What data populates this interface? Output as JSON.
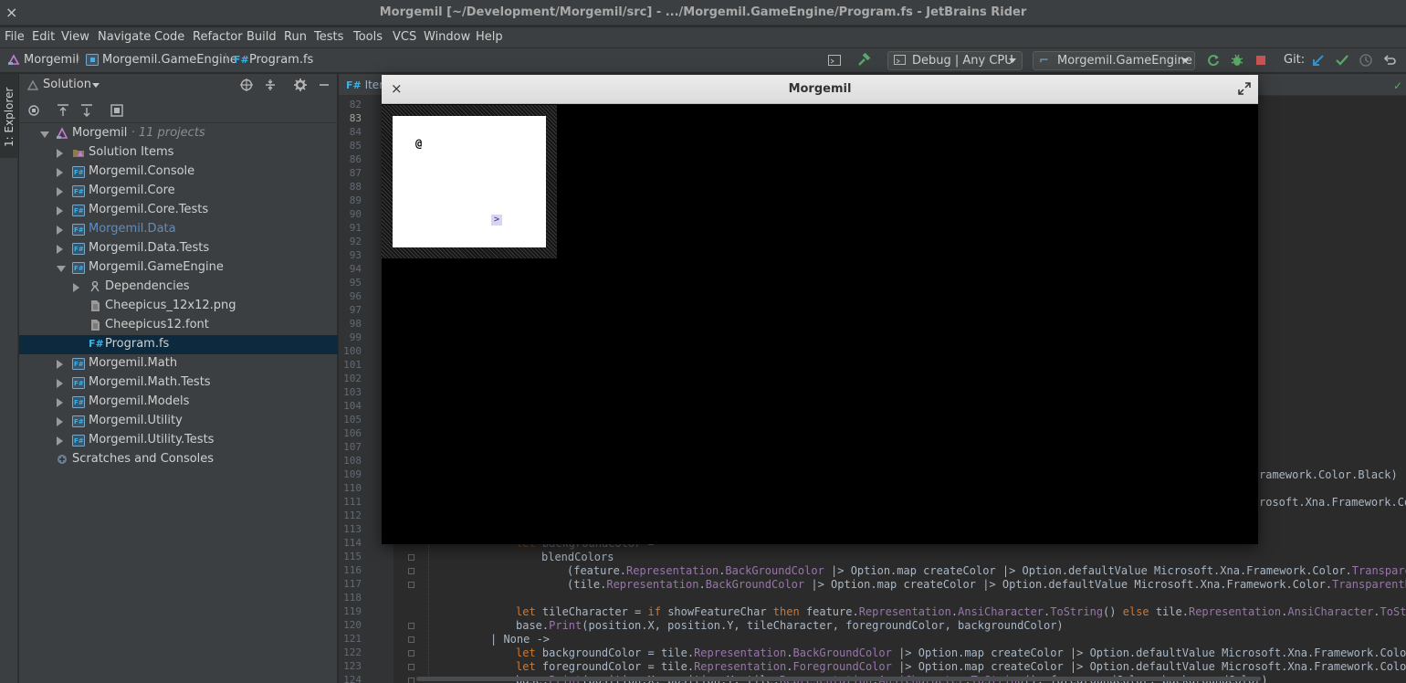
{
  "window": {
    "title": "Morgemil [~/Development/Morgemil/src] - .../Morgemil.GameEngine/Program.fs - JetBrains Rider",
    "close_glyph": "×"
  },
  "menu": [
    "File",
    "Edit",
    "View",
    "Navigate",
    "Code",
    "Refactor",
    "Build",
    "Run",
    "Tests",
    "Tools",
    "VCS",
    "Window",
    "Help"
  ],
  "breadcrumb": {
    "items": [
      "Morgemil",
      "Morgemil.GameEngine",
      "Program.fs"
    ],
    "fs_badge": "F#"
  },
  "toolbar": {
    "config_combo": "Debug | Any CPU",
    "project_combo": "Morgemil.GameEngine",
    "git_label": "Git:"
  },
  "explorer_strip": {
    "label": "1: Explorer"
  },
  "solution_panel": {
    "title": "Solution",
    "tree": [
      {
        "label": "Morgemil",
        "suffix": " · 11 projects",
        "level": 0,
        "state": "down",
        "icon": "solution"
      },
      {
        "label": "Solution Items",
        "level": 1,
        "state": "right",
        "icon": "folder-solution"
      },
      {
        "label": "Morgemil.Console",
        "level": 1,
        "state": "right",
        "icon": "fsproj"
      },
      {
        "label": "Morgemil.Core",
        "level": 1,
        "state": "right",
        "icon": "fsproj"
      },
      {
        "label": "Morgemil.Core.Tests",
        "level": 1,
        "state": "right",
        "icon": "fsproj"
      },
      {
        "label": "Morgemil.Data",
        "level": 1,
        "state": "right",
        "icon": "fsproj",
        "highlight": true
      },
      {
        "label": "Morgemil.Data.Tests",
        "level": 1,
        "state": "right",
        "icon": "fsproj"
      },
      {
        "label": "Morgemil.GameEngine",
        "level": 1,
        "state": "down",
        "icon": "fsproj"
      },
      {
        "label": "Dependencies",
        "level": 2,
        "state": "right",
        "icon": "deps"
      },
      {
        "label": "Cheepicus_12x12.png",
        "level": 2,
        "state": "none",
        "icon": "file"
      },
      {
        "label": "Cheepicus12.font",
        "level": 2,
        "state": "none",
        "icon": "file"
      },
      {
        "label": "Program.fs",
        "level": 2,
        "state": "none",
        "icon": "fs",
        "selected": true
      },
      {
        "label": "Morgemil.Math",
        "level": 1,
        "state": "right",
        "icon": "fsproj"
      },
      {
        "label": "Morgemil.Math.Tests",
        "level": 1,
        "state": "right",
        "icon": "fsproj"
      },
      {
        "label": "Morgemil.Models",
        "level": 1,
        "state": "right",
        "icon": "fsproj"
      },
      {
        "label": "Morgemil.Utility",
        "level": 1,
        "state": "right",
        "icon": "fsproj"
      },
      {
        "label": "Morgemil.Utility.Tests",
        "level": 1,
        "state": "right",
        "icon": "fsproj"
      },
      {
        "label": "Scratches and Consoles",
        "level": 0,
        "state": "none",
        "icon": "scratches"
      }
    ]
  },
  "editor": {
    "tab_label": "Iter",
    "tab_badge": "F#",
    "line_numbers": [
      "82",
      "83",
      "84",
      "85",
      "86",
      "87",
      "88",
      "89",
      "90",
      "91",
      "92",
      "93",
      "94",
      "95",
      "96",
      "97",
      "98",
      "99",
      "100",
      "101",
      "102",
      "103",
      "104",
      "105",
      "106",
      "107",
      "108",
      "109",
      "110",
      "111",
      "112",
      "113",
      "114",
      "115",
      "116",
      "117",
      "118",
      "119",
      "120",
      "121",
      "122",
      "123",
      "124"
    ],
    "current_line": "83",
    "visible_right_fragments": {
      "109": "ramework.Color.Black)",
      "111": "rosoft.Xna.Framework.Co"
    },
    "code_lines": [
      {
        "n": "114",
        "tokens": [
          [
            "kw",
            "let "
          ],
          [
            "",
            "backgroundColor ="
          ]
        ],
        "indent": 0,
        "faded": true
      },
      {
        "n": "115",
        "tokens": [
          [
            "",
            "blendColors"
          ]
        ],
        "indent": 1
      },
      {
        "n": "116",
        "tokens": [
          [
            "",
            "(feature."
          ],
          [
            "pr",
            "Representation"
          ],
          [
            "",
            "."
          ],
          [
            "pr",
            "BackGroundColor"
          ],
          [
            "",
            " |> Option.map createColor |> Option.defaultValue Microsoft.Xna.Framework.Color."
          ],
          [
            "pr",
            "TransparentB"
          ]
        ],
        "indent": 2
      },
      {
        "n": "117",
        "tokens": [
          [
            "",
            "(tile."
          ],
          [
            "pr",
            "Representation"
          ],
          [
            "",
            "."
          ],
          [
            "pr",
            "BackGroundColor"
          ],
          [
            "",
            " |> Option.map createColor |> Option.defaultValue Microsoft.Xna.Framework.Color."
          ],
          [
            "pr",
            "TransparentBlac"
          ]
        ],
        "indent": 2
      },
      {
        "n": "118",
        "tokens": [],
        "indent": 0
      },
      {
        "n": "119",
        "tokens": [
          [
            "kw",
            "let "
          ],
          [
            "",
            "tileCharacter = "
          ],
          [
            "kw",
            "if "
          ],
          [
            "",
            "showFeatureChar "
          ],
          [
            "kw",
            "then "
          ],
          [
            "",
            "feature."
          ],
          [
            "pr",
            "Representation"
          ],
          [
            "",
            "."
          ],
          [
            "pr",
            "AnsiCharacter"
          ],
          [
            "",
            "."
          ],
          [
            "pr",
            "ToString"
          ],
          [
            "",
            "() "
          ],
          [
            "kw",
            "else "
          ],
          [
            "",
            "tile."
          ],
          [
            "pr",
            "Representation"
          ],
          [
            "",
            "."
          ],
          [
            "pr",
            "AnsiCharacter"
          ],
          [
            "",
            "."
          ],
          [
            "pr",
            "ToString"
          ]
        ],
        "indent": 0
      },
      {
        "n": "120",
        "tokens": [
          [
            "",
            "base."
          ],
          [
            "pr",
            "Print"
          ],
          [
            "",
            "(position.X, position.Y, tileCharacter, foregroundColor, backgroundColor)"
          ]
        ],
        "indent": 0
      },
      {
        "n": "121",
        "tokens": [
          [
            "",
            "| None ->"
          ]
        ],
        "indent": -1
      },
      {
        "n": "122",
        "tokens": [
          [
            "kw",
            "let "
          ],
          [
            "",
            "backgroundColor = tile."
          ],
          [
            "pr",
            "Representation"
          ],
          [
            "",
            "."
          ],
          [
            "pr",
            "BackGroundColor"
          ],
          [
            "",
            " |> Option.map createColor |> Option.defaultValue Microsoft.Xna.Framework.Color.Bl"
          ]
        ],
        "indent": 0
      },
      {
        "n": "123",
        "tokens": [
          [
            "kw",
            "let "
          ],
          [
            "",
            "foregroundColor = tile."
          ],
          [
            "pr",
            "Representation"
          ],
          [
            "",
            "."
          ],
          [
            "pr",
            "ForegroundColor"
          ],
          [
            "",
            " |> Option.map createColor |> Option.defaultValue Microsoft.Xna.Framework.Color.Wh"
          ]
        ],
        "indent": 0
      },
      {
        "n": "124",
        "tokens": [
          [
            "",
            "base."
          ],
          [
            "pr",
            "Print"
          ],
          [
            "",
            "(position.X, position.Y, tile."
          ],
          [
            "pr",
            "Representation"
          ],
          [
            "",
            "."
          ],
          [
            "pr",
            "AnsiCharacter"
          ],
          [
            "",
            "."
          ],
          [
            "pr",
            "ToString"
          ],
          [
            "",
            "(), foregroundColor, backgroundColor)"
          ]
        ],
        "indent": 0
      }
    ]
  },
  "game_window": {
    "title": "Morgemil",
    "close_glyph": "×",
    "player_glyph": "@",
    "stairs_glyph": ">"
  },
  "colors": {
    "keyword": "#cc7832",
    "property": "#9876aa",
    "default_code": "#a9b7c6",
    "selection": "#0d293e",
    "accent_green": "#59a869",
    "accent_red": "#c75450"
  },
  "icons": {
    "rebuild": "hammer-icon",
    "run": "rerun-icon",
    "debug": "bug-icon",
    "stop": "stop-icon",
    "git_update": "git-update-icon",
    "git_commit": "git-commit-icon",
    "git_history": "git-history-icon",
    "git_revert": "git-revert-icon"
  }
}
